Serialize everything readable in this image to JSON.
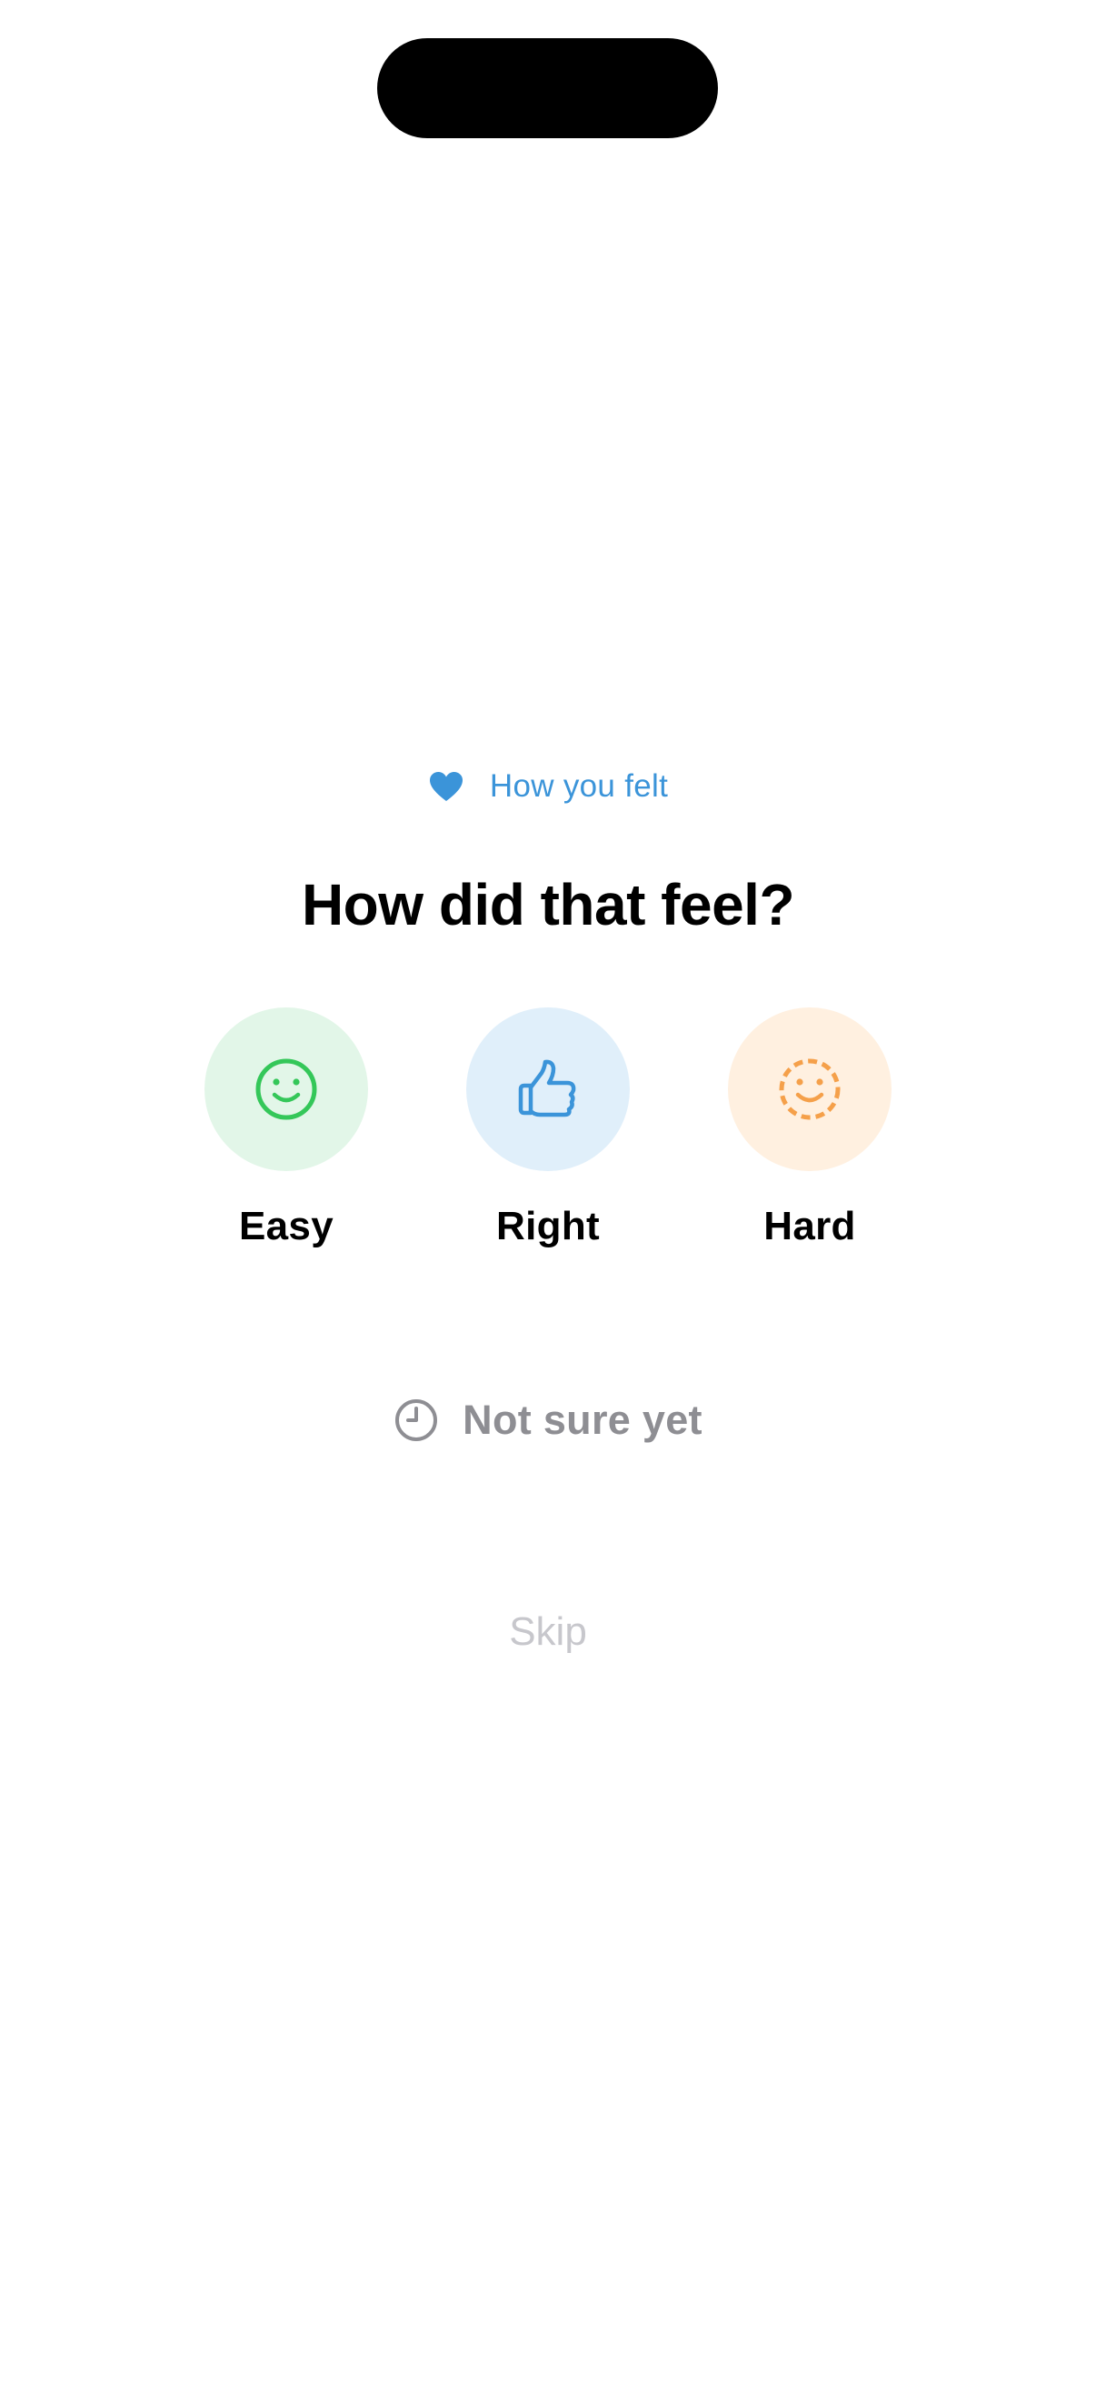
{
  "eyebrow": {
    "icon": "heart-icon",
    "label": "How you felt",
    "color": "#3B94D9"
  },
  "title": "How did that feel?",
  "options": [
    {
      "id": "easy",
      "label": "Easy",
      "icon": "smiley-face-icon",
      "color": "#34C759",
      "background": "#E2F6E8"
    },
    {
      "id": "right",
      "label": "Right",
      "icon": "thumbs-up-icon",
      "color": "#3B94D9",
      "background": "#E0EFFA"
    },
    {
      "id": "hard",
      "label": "Hard",
      "icon": "dashed-smiley-face-icon",
      "color": "#F5A04A",
      "background": "#FFF0E0"
    }
  ],
  "not_sure": {
    "icon": "clock-icon",
    "label": "Not sure yet",
    "color": "#8E8E93"
  },
  "skip": {
    "label": "Skip",
    "color": "#C7C7CC"
  }
}
